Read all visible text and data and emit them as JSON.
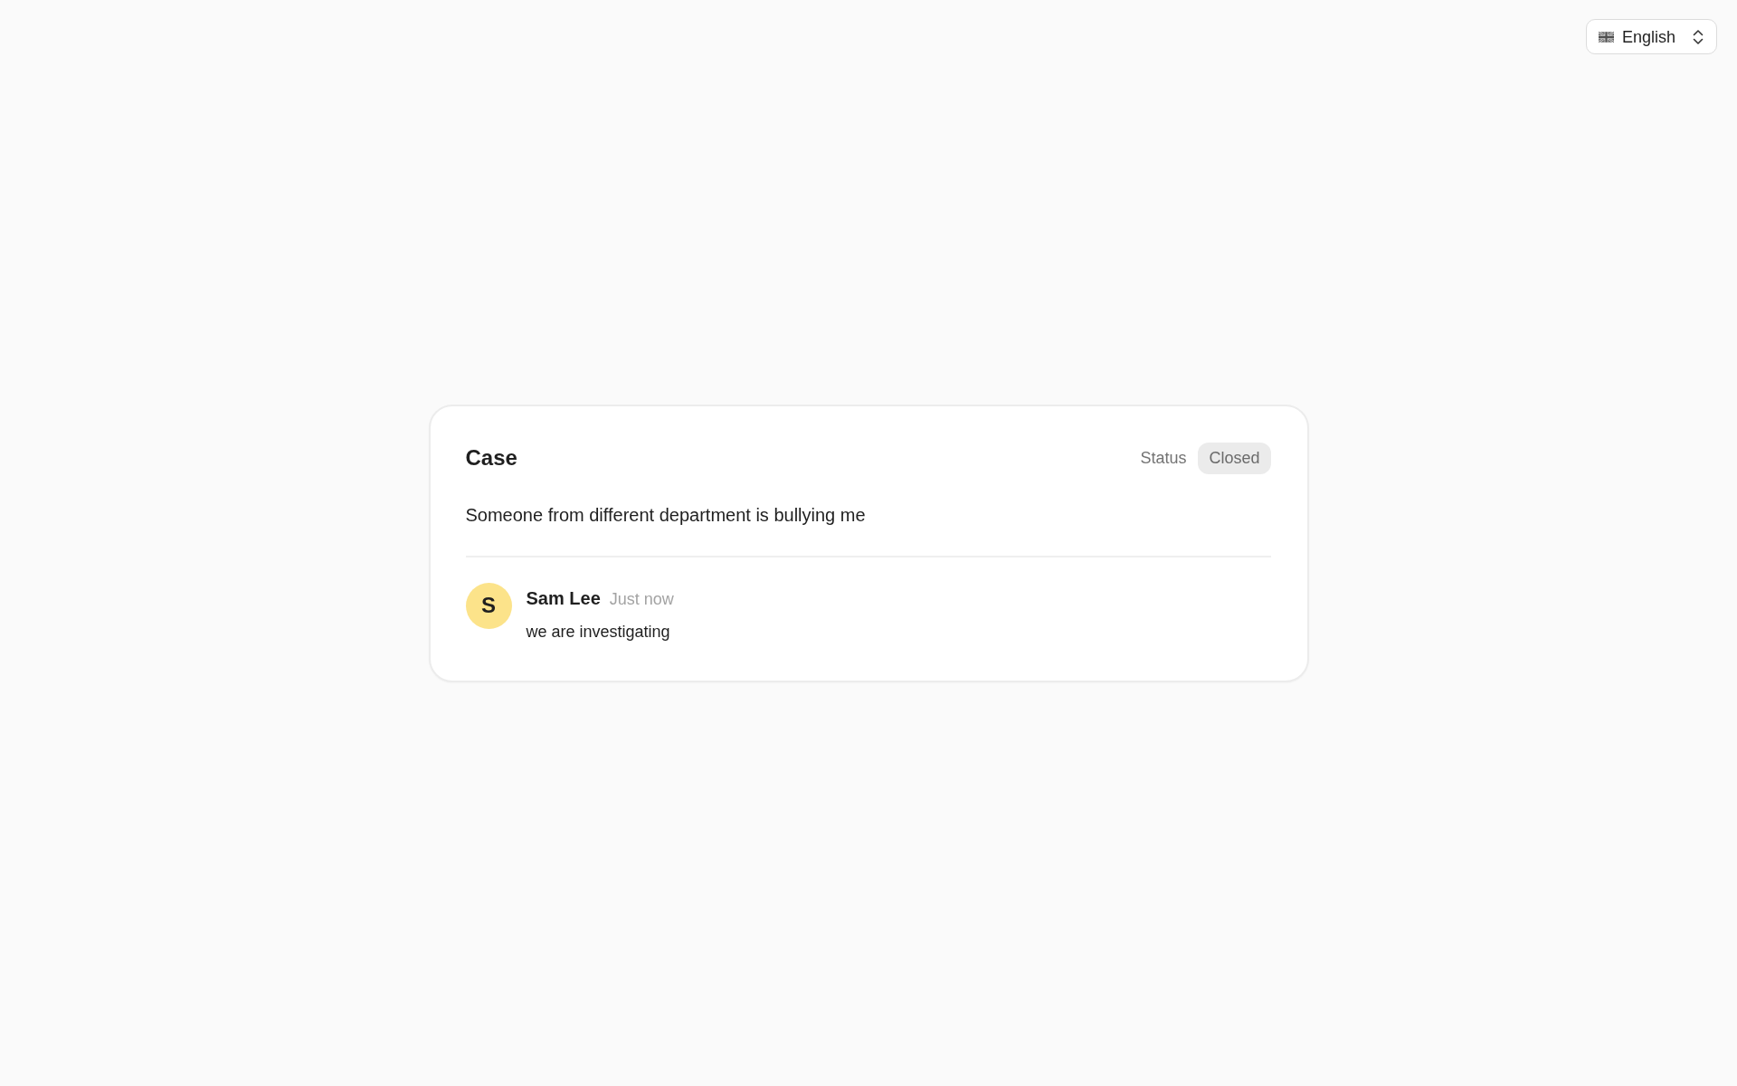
{
  "language_selector": {
    "value": "English"
  },
  "case": {
    "title": "Case",
    "status_label": "Status",
    "status": "Closed",
    "description": "Someone from different department is bullying me"
  },
  "comments": [
    {
      "avatar_initial": "S",
      "author": "Sam Lee",
      "time": "Just now",
      "text": "we are investigating"
    }
  ]
}
